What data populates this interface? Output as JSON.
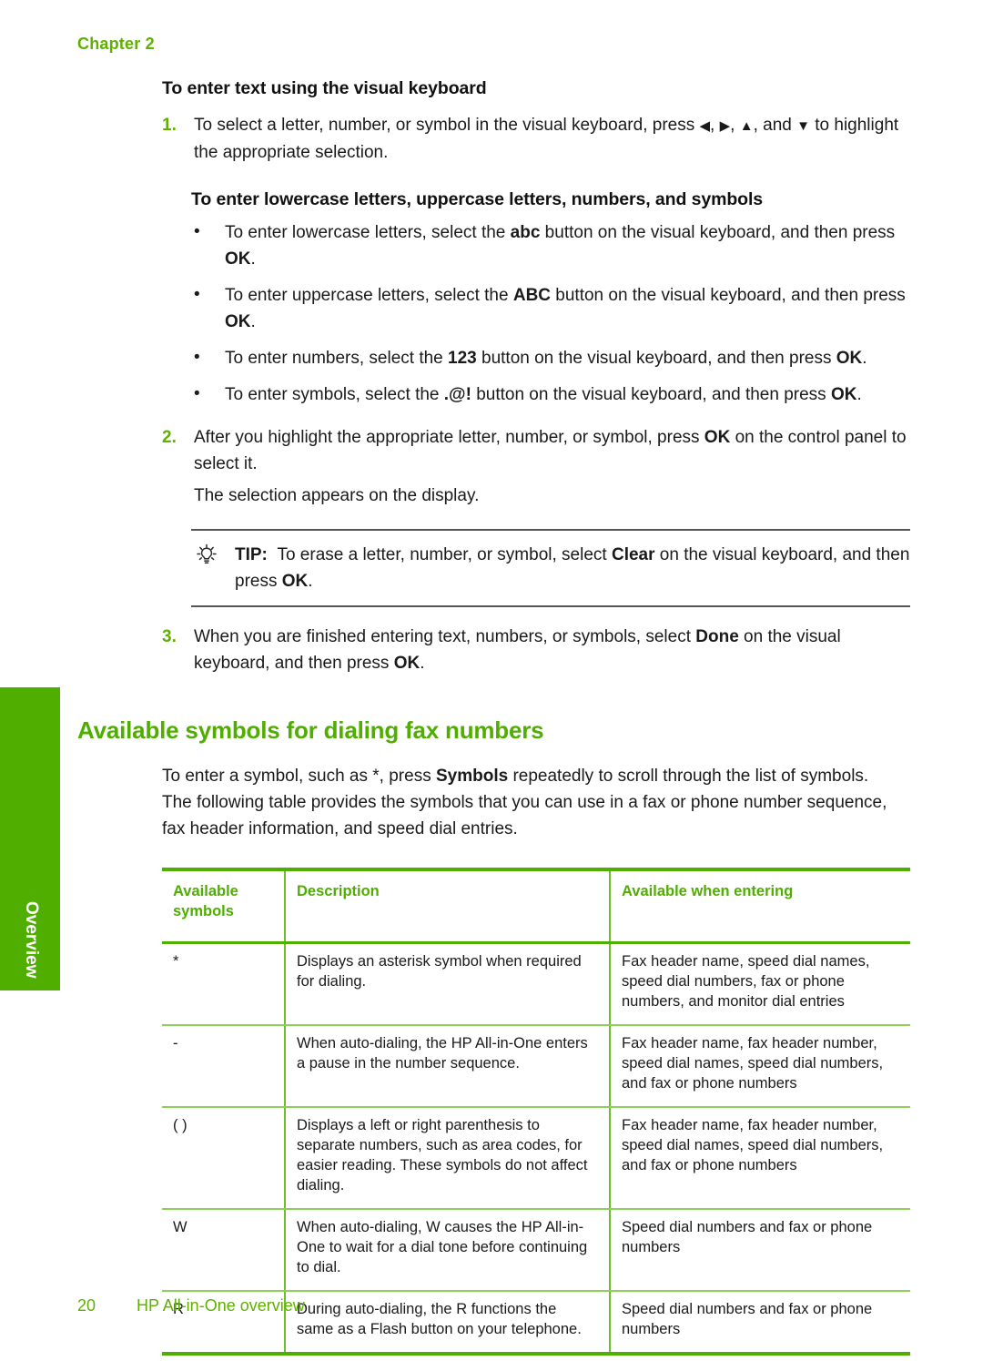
{
  "page": {
    "chapter_label": "Chapter 2",
    "page_number": "20",
    "footer_title": "HP All-in-One overview",
    "side_tab_label": "Overview",
    "accent_green": "#4fae00",
    "heading_green": "#5fb000",
    "table_rule_green": "#8fd157"
  },
  "procedure": {
    "heading": "To enter text using the visual keyboard",
    "step1": {
      "number": "1.",
      "text_a": "To select a letter, number, or symbol in the visual keyboard, press ",
      "arrow_left": "◀",
      "sep1": ", ",
      "arrow_right": "▶",
      "sep2": ", ",
      "arrow_up": "▲",
      "text_b": ", and ",
      "arrow_down": "▼",
      "text_c": " to highlight the appropriate selection."
    },
    "subheading": "To enter lowercase letters, uppercase letters, numbers, and symbols",
    "bullets": [
      {
        "marker": "•",
        "text_a": "To enter lowercase letters, select the ",
        "bold_a": "abc",
        "text_b": " button on the visual keyboard, and then press ",
        "bold_b": "OK",
        "text_c": "."
      },
      {
        "marker": "•",
        "text_a": "To enter uppercase letters, select the ",
        "bold_a": "ABC",
        "text_b": " button on the visual keyboard, and then press ",
        "bold_b": "OK",
        "text_c": "."
      },
      {
        "marker": "•",
        "text_a": "To enter numbers, select the ",
        "bold_a": "123",
        "text_b": " button on the visual keyboard, and then press ",
        "bold_b": "OK",
        "text_c": "."
      },
      {
        "marker": "•",
        "text_a": "To enter symbols, select the ",
        "bold_a": ".@!",
        "text_b": " button on the visual keyboard, and then press ",
        "bold_b": "OK",
        "text_c": "."
      }
    ],
    "step2": {
      "number": "2.",
      "text_a": "After you highlight the appropriate letter, number, or symbol, press ",
      "bold_a": "OK",
      "text_b": " on the control panel to select it.",
      "sub_text": "The selection appears on the display."
    },
    "tip": {
      "icon": "lightbulb-icon",
      "label": "TIP:",
      "text_a": "To erase a letter, number, or symbol, select ",
      "bold_a": "Clear",
      "text_b": " on the visual keyboard, and then press ",
      "bold_b": "OK",
      "text_c": "."
    },
    "step3": {
      "number": "3.",
      "text_a": "When you are finished entering text, numbers, or symbols, select ",
      "bold_a": "Done",
      "text_b": " on the visual keyboard, and then press ",
      "bold_b": "OK",
      "text_c": "."
    }
  },
  "section": {
    "heading": "Available symbols for dialing fax numbers",
    "intro_a": "To enter a symbol, such as *, press ",
    "intro_bold": "Symbols",
    "intro_b": " repeatedly to scroll through the list of symbols. The following table provides the symbols that you can use in a fax or phone number sequence, fax header information, and speed dial entries."
  },
  "table": {
    "headers": [
      "Available symbols",
      "Description",
      "Available when entering"
    ],
    "rows": [
      {
        "symbol": "*",
        "description": "Displays an asterisk symbol when required for dialing.",
        "available_when": "Fax header name, speed dial names, speed dial numbers, fax or phone numbers, and monitor dial entries"
      },
      {
        "symbol": "-",
        "description": "When auto-dialing, the HP All-in-One enters a pause in the number sequence.",
        "available_when": "Fax header name, fax header number, speed dial names, speed dial numbers, and fax or phone numbers"
      },
      {
        "symbol": "( )",
        "description": "Displays a left or right parenthesis to separate numbers, such as area codes, for easier reading. These symbols do not affect dialing.",
        "available_when": "Fax header name, fax header number, speed dial names, speed dial numbers, and fax or phone numbers"
      },
      {
        "symbol": "W",
        "description": "When auto-dialing, W causes the HP All-in-One to wait for a dial tone before continuing to dial.",
        "available_when": "Speed dial numbers and fax or phone numbers"
      },
      {
        "symbol": "R",
        "description": "During auto-dialing, the R functions the same as a Flash button on your telephone.",
        "available_when": "Speed dial numbers and fax or phone numbers"
      }
    ]
  }
}
